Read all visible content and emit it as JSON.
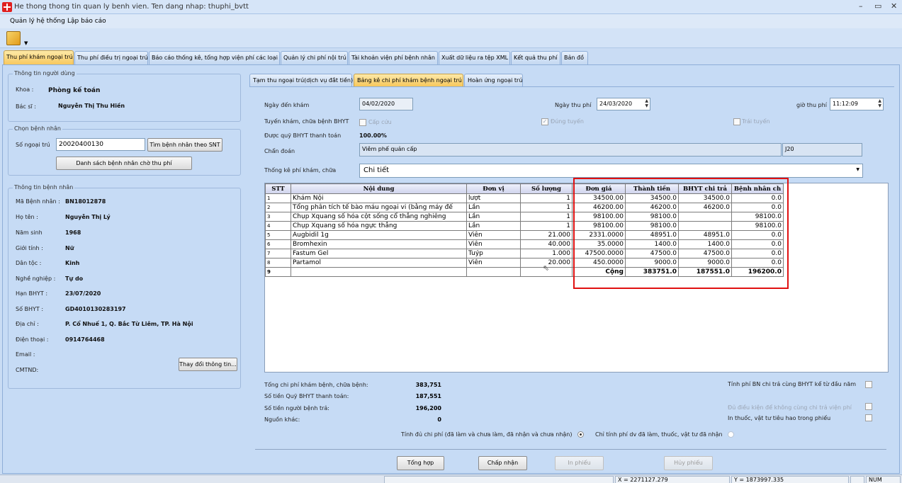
{
  "window": {
    "title": "He thong thong tin quan ly benh vien. Ten dang nhap: thuphi_bvtt",
    "minimize": "–",
    "restore": "▭",
    "close": "✕"
  },
  "menu": [
    "Quản lý hệ thống",
    "Lập báo cáo"
  ],
  "main_tabs": [
    "Thu phí khám ngoại trú",
    "Thu phí điều trị ngoại trú",
    "Báo cáo thống kê, tổng hợp viện phí các loại",
    "Quản lý chi phí nội trú",
    "Tài khoản viện phí bệnh nhân",
    "Xuất dữ liệu ra tệp XML",
    "Kết quả thu phí",
    "Bản đồ"
  ],
  "user_info": {
    "legend": "Thông tin người dùng",
    "khoa_label": "Khoa :",
    "khoa_value": "Phòng kế toán",
    "bacsi_label": "Bác sĩ :",
    "bacsi_value": "Nguyễn Thị Thu Hiền"
  },
  "patient_select": {
    "legend": "Chọn bệnh nhân",
    "so_label": "Số ngoại trú",
    "so_value": "20020400130",
    "find_btn": "Tìm bệnh nhân theo SNT",
    "list_btn": "Danh sách bệnh nhân chờ thu phí"
  },
  "patient_info": {
    "legend": "Thông tin bệnh nhân",
    "fields": [
      {
        "label": "Mã Bệnh nhân :",
        "value": "BN18012878"
      },
      {
        "label": "Họ tên :",
        "value": "Nguyễn Thị Lý"
      },
      {
        "label": "Năm sinh",
        "value": "1968"
      },
      {
        "label": "Giới tính :",
        "value": "Nữ"
      },
      {
        "label": "Dân tộc :",
        "value": "Kinh"
      },
      {
        "label": "Nghề nghiệp :",
        "value": "Tự do"
      },
      {
        "label": "Hạn BHYT :",
        "value": "23/07/2020"
      },
      {
        "label": "Số BHYT :",
        "value": "GD4010130283197"
      },
      {
        "label": "Địa chỉ :",
        "value": "P. Cổ Nhuế 1, Q. Bắc Từ Liêm, TP. Hà Nội"
      },
      {
        "label": "Điện thoại :",
        "value": "0914764468"
      },
      {
        "label": "Email :",
        "value": ""
      },
      {
        "label": "CMTND:",
        "value": ""
      }
    ],
    "change_btn": "Thay đổi thông tin..."
  },
  "sub_tabs": [
    "Tạm thu ngoại trú(dịch vụ đắt tiền)",
    "Bảng kê chi phí khám bệnh ngoại trú",
    "Hoàn ứng ngoại trú"
  ],
  "form": {
    "ngay_den_label": "Ngày đến khám",
    "ngay_den_value": "04/02/2020",
    "ngay_thu_label": "Ngày thu phí",
    "ngay_thu_value": "24/03/2020",
    "gio_thu_label": "giờ thu phí",
    "gio_thu_value": "11:12:09",
    "tuyen_label": "Tuyến khám, chữa bệnh BHYT",
    "cap_cuu": "Cấp cứu",
    "dung_tuyen": "Đúng tuyến",
    "trai_tuyen": "Trái tuyến",
    "quy_label": "Được quỹ BHYT thanh toán",
    "quy_value": "100.00%",
    "chan_doan_label": "Chẩn đoán",
    "chan_doan_value": "Viêm phế quản cấp",
    "icd_value": "J20",
    "thong_ke_label": "Thống kê phí khám, chữa",
    "thong_ke_value": "Chi tiết"
  },
  "table": {
    "headers": [
      "STT",
      "Nội dung",
      "Đơn vị",
      "Số lượng",
      "Đơn giá",
      "Thành tiền",
      "BHYT chi trả",
      "Bệnh nhân ch"
    ],
    "rows": [
      [
        "1",
        "Khám Nội",
        "lượt",
        "1",
        "34500.00",
        "34500.0",
        "34500.0",
        "0.0"
      ],
      [
        "2",
        "Tổng phân tích tế bào máu ngoại vi (bằng máy đế",
        "Lần",
        "1",
        "46200.00",
        "46200.0",
        "46200.0",
        "0.0"
      ],
      [
        "3",
        "Chụp Xquang số hóa cột sống cổ thẳng nghiêng",
        "Lần",
        "1",
        "98100.00",
        "98100.0",
        "",
        "98100.0"
      ],
      [
        "4",
        "Chụp Xquang số hóa ngực thẳng",
        "Lần",
        "1",
        "98100.00",
        "98100.0",
        "",
        "98100.0"
      ],
      [
        "5",
        "Augbidil 1g",
        "Viên",
        "21.000",
        "2331.0000",
        "48951.0",
        "48951.0",
        "0.0"
      ],
      [
        "6",
        "Bromhexin",
        "Viên",
        "40.000",
        "35.0000",
        "1400.0",
        "1400.0",
        "0.0"
      ],
      [
        "7",
        "Fastum Gel",
        "Tuýp",
        "1.000",
        "47500.0000",
        "47500.0",
        "47500.0",
        "0.0"
      ],
      [
        "8",
        "Partamol",
        "Viên",
        "20.000",
        "450.0000",
        "9000.0",
        "9000.0",
        "0.0"
      ]
    ],
    "total_row": {
      "stt": "9",
      "label": "Cộng",
      "thanh_tien": "383751.0",
      "bhyt": "187551.0",
      "benh_nhan": "196200.0"
    }
  },
  "summary": [
    {
      "label": "Tổng chi phí khám bệnh, chữa bệnh:",
      "value": "383,751"
    },
    {
      "label": "Số tiền Quỹ BHYT thanh toán:",
      "value": "187,551"
    },
    {
      "label": "Số tiền người bệnh trả:",
      "value": "196,200"
    },
    {
      "label": "Nguồn khác:",
      "value": "0"
    }
  ],
  "options": {
    "tinh_phi_bn": "Tính phí BN chi trả cùng BHYT kể từ đầu năm",
    "du_dieu_kien": "Đủ điều kiện để không cùng chi trả viện phí",
    "in_thuoc": "In thuốc, vật tư tiêu hao trong phiếu",
    "radio_all": "Tính đủ chi phí (đã làm và chưa làm, đã nhận và chưa nhận)",
    "radio_done": "Chỉ tính phí dv đã làm, thuốc, vật tư đã nhận"
  },
  "buttons": {
    "tong_hop": "Tổng hợp",
    "chap_nhan": "Chấp nhận",
    "in_phieu": "In phiếu",
    "huy_phieu": "Hủy phiếu"
  },
  "status": {
    "x": "X = 2271127.279",
    "y": "Y = 1873997.335",
    "num": "NUM"
  }
}
